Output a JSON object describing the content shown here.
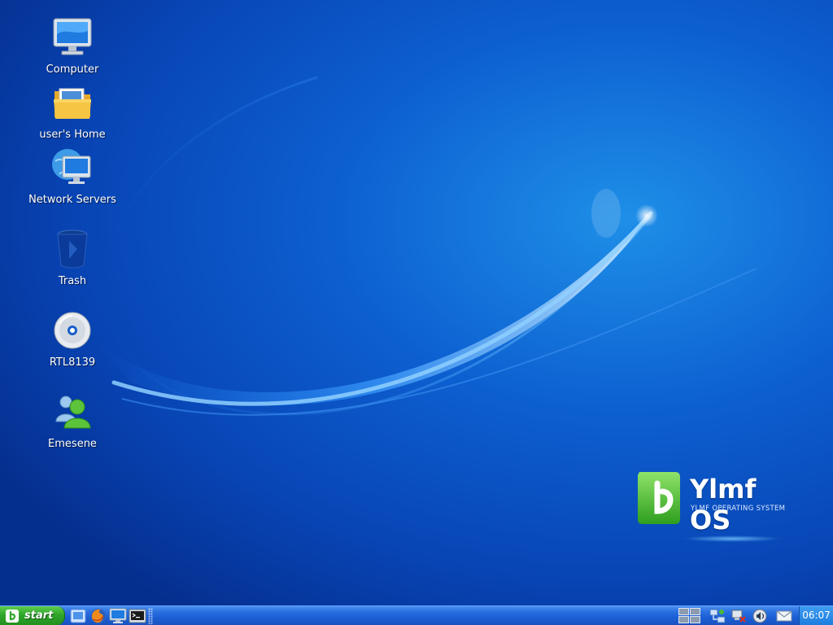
{
  "desktop": {
    "icons": [
      {
        "label": "Computer",
        "icon": "computer-icon"
      },
      {
        "label": "user's Home",
        "icon": "home-folder-icon"
      },
      {
        "label": "Network Servers",
        "icon": "network-servers-icon"
      },
      {
        "label": "Trash",
        "icon": "trash-icon"
      },
      {
        "label": "RTL8139",
        "icon": "cd-drive-icon"
      },
      {
        "label": "Emesene",
        "icon": "emesene-icon"
      }
    ]
  },
  "branding": {
    "name": "Ylmf OS",
    "subtitle": "YLMF OPERATING SYSTEM"
  },
  "taskbar": {
    "start_label": "start",
    "quick_launch": [
      "show-desktop-icon",
      "firefox-icon",
      "computer-icon",
      "terminal-icon"
    ],
    "tray": [
      "workspace-pager",
      "network-icon",
      "network-disconnected-icon",
      "volume-icon",
      "mail-icon"
    ],
    "clock": "06:07"
  },
  "colors": {
    "taskbar": "#1b5fd6",
    "start_button": "#2fa62a",
    "clock_bg": "#1d7ee0",
    "logo_green": "#4cc23a"
  }
}
